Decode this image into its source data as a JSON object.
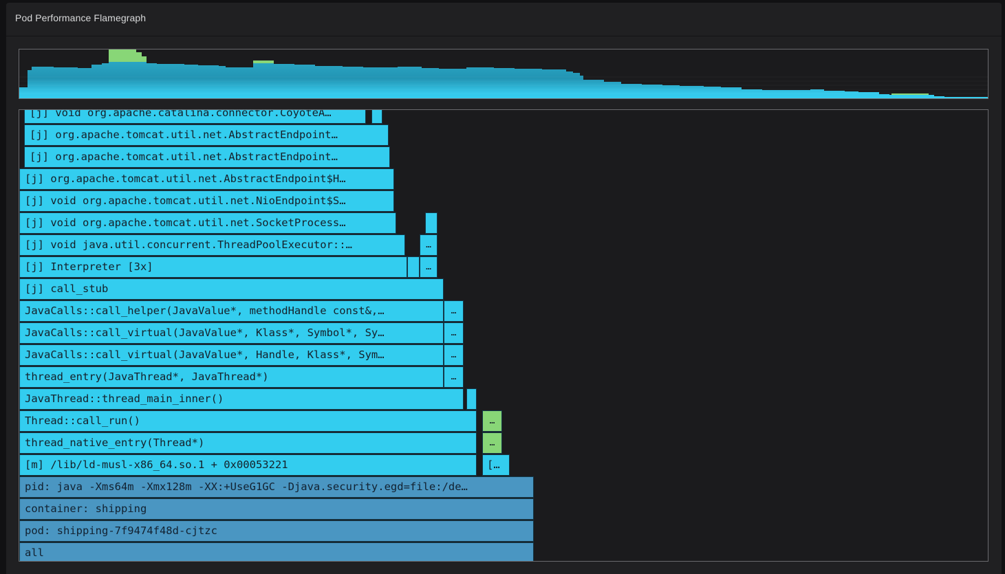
{
  "panel": {
    "title": "Pod Performance Flamegraph"
  },
  "colors": {
    "frame": "#33cdef",
    "frame_alt": "#88d677",
    "root": "#4a96c2",
    "background": "#202022"
  },
  "frames": [
    {
      "label": "[j] void org.apache.catalina.connector.CoyoteA…"
    },
    {
      "label": "[j] org.apache.tomcat.util.net.AbstractEndpoint…"
    },
    {
      "label": "[j] org.apache.tomcat.util.net.AbstractEndpoint…"
    },
    {
      "label": "[j] org.apache.tomcat.util.net.AbstractEndpoint$H…"
    },
    {
      "label": "[j] void org.apache.tomcat.util.net.NioEndpoint$S…"
    },
    {
      "label": "[j] void org.apache.tomcat.util.net.SocketProcess…"
    },
    {
      "label": "[j] void java.util.concurrent.ThreadPoolExecutor::…"
    },
    {
      "label": "[j] Interpreter [3x]"
    },
    {
      "label": "[j] call_stub"
    },
    {
      "label": "JavaCalls::call_helper(JavaValue*, methodHandle const&,…"
    },
    {
      "label": "JavaCalls::call_virtual(JavaValue*, Klass*, Symbol*, Sy…"
    },
    {
      "label": "JavaCalls::call_virtual(JavaValue*, Handle, Klass*, Sym…"
    },
    {
      "label": "thread_entry(JavaThread*, JavaThread*)"
    },
    {
      "label": "JavaThread::thread_main_inner()"
    },
    {
      "label": "Thread::call_run()"
    },
    {
      "label": "thread_native_entry(Thread*)"
    },
    {
      "label": "[m] /lib/ld-musl-x86_64.so.1 + 0x00053221"
    },
    {
      "label": "pid: java -Xms64m -Xmx128m -XX:+UseG1GC -Djava.security.egd=file:/de…"
    },
    {
      "label": "container: shipping"
    },
    {
      "label": "pod: shipping-7f9474f48d-cjtzc"
    },
    {
      "label": "all"
    }
  ],
  "truncated_label": "…",
  "truncated_bracket_label": "[…"
}
